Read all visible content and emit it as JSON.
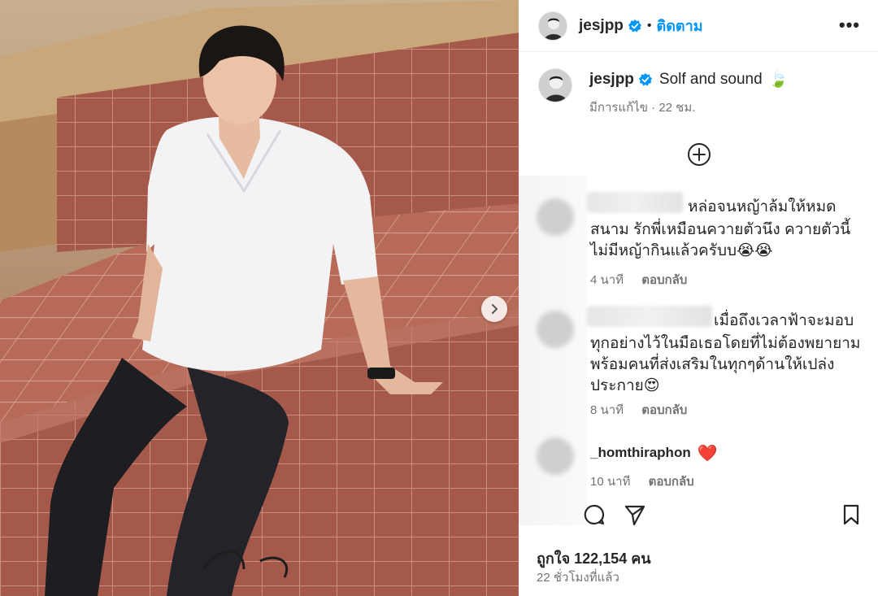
{
  "post": {
    "author": "jesjpp",
    "follow_label": "ติดตาม",
    "separator": "•",
    "more_label": "•••",
    "caption_text": "Solf and sound",
    "caption_emoji": "🍃",
    "edited_meta": "มีการแก้ไข · 22 ชม."
  },
  "comments": [
    {
      "text_line1": "หล่อจนหญ้าล้มให้หมด",
      "text_rest": "สนาม รักพี่เหมือนควายตัวนึง ควายตัวนี้ไม่มีหญ้ากินแล้วครับบ😭😭",
      "time": "4 นาที",
      "reply": "ตอบกลับ"
    },
    {
      "text_line1": "เมื่อถึงเวลาฟ้าจะมอบ",
      "text_rest": "ทุกอย่างไว้ในมือเธอโดยที่ไม่ต้องพยายามพร้อมคนที่ส่งเสริมในทุกๆด้านให้เปล่งประกาย😍",
      "time": "8 นาที",
      "reply": "ตอบกลับ"
    },
    {
      "username": "_homthiraphon",
      "text": "❤️",
      "time": "10 นาที",
      "reply": "ตอบกลับ"
    }
  ],
  "engagement": {
    "likes": "ถูกใจ 122,154 คน",
    "time_ago": "22 ชั่วโมงที่แล้ว"
  },
  "colors": {
    "accent": "#0095f6",
    "verified": "#0095f6",
    "text": "#262626",
    "muted": "#737373",
    "heart": "#ed4956"
  },
  "icons": [
    "chevron-right-icon",
    "verified-badge-icon",
    "add-circle-icon",
    "comment-icon",
    "share-icon",
    "bookmark-icon",
    "more-icon"
  ]
}
